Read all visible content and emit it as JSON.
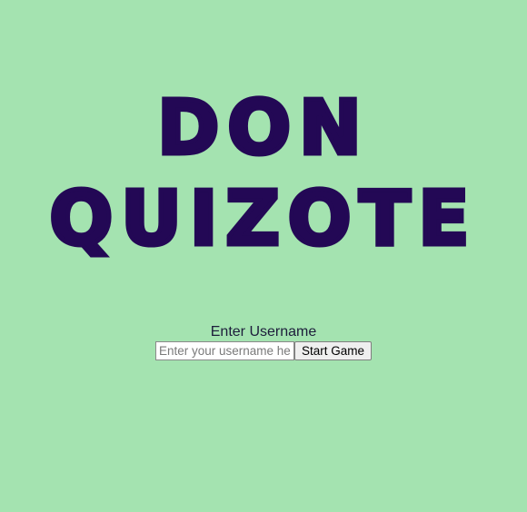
{
  "title": {
    "line1": "DON",
    "line2": "QUIZOTE"
  },
  "login": {
    "label": "Enter Username",
    "input_placeholder": "Enter your username here",
    "input_value": "",
    "start_button_label": "Start Game"
  },
  "colors": {
    "background": "#a4e3b0",
    "title": "#230855",
    "label_text": "#1d1d3b"
  }
}
